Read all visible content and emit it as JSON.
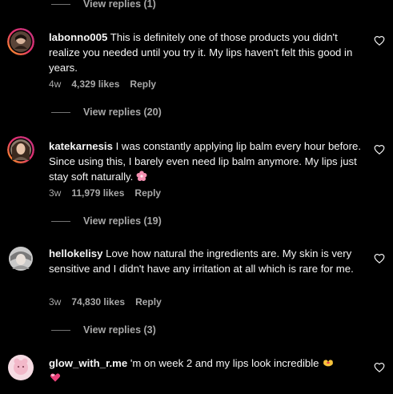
{
  "comments": [
    {
      "username": "labonno005",
      "text": "This is definitely one of those products you didn't realize you needed until you try it. My lips haven't felt this good in years.",
      "time": "4w",
      "likes": "4,329 likes",
      "reply_label": "Reply",
      "view_replies": "View replies (20)"
    },
    {
      "username": "katekarnesis",
      "text": "I was constantly applying lip balm every hour before. Since using this, I barely even need lip balm anymore. My lips just stay soft naturally.",
      "emoji": "cherry-blossom-emoji",
      "time": "3w",
      "likes": "11,979 likes",
      "reply_label": "Reply",
      "view_replies": "View replies (19)"
    },
    {
      "username": "hellokelisy",
      "text": "Love how natural the ingredients are. My skin is very sensitive and I didn't have any irritation at all which is rare for me.",
      "time": "3w",
      "likes": "74,830 likes",
      "reply_label": "Reply",
      "view_replies": "View replies (3)"
    },
    {
      "username": "glow_with_r.me",
      "text": "'m on week 2 and my lips look incredible",
      "emoji": "heart-hands-emoji, pink-hearts-emoji"
    }
  ],
  "top_view_replies": "View replies (1)",
  "colors": {
    "background": "#000000",
    "primary_text": "#f5f5f5",
    "secondary_text": "#a8a8a8",
    "divider": "#737373"
  }
}
